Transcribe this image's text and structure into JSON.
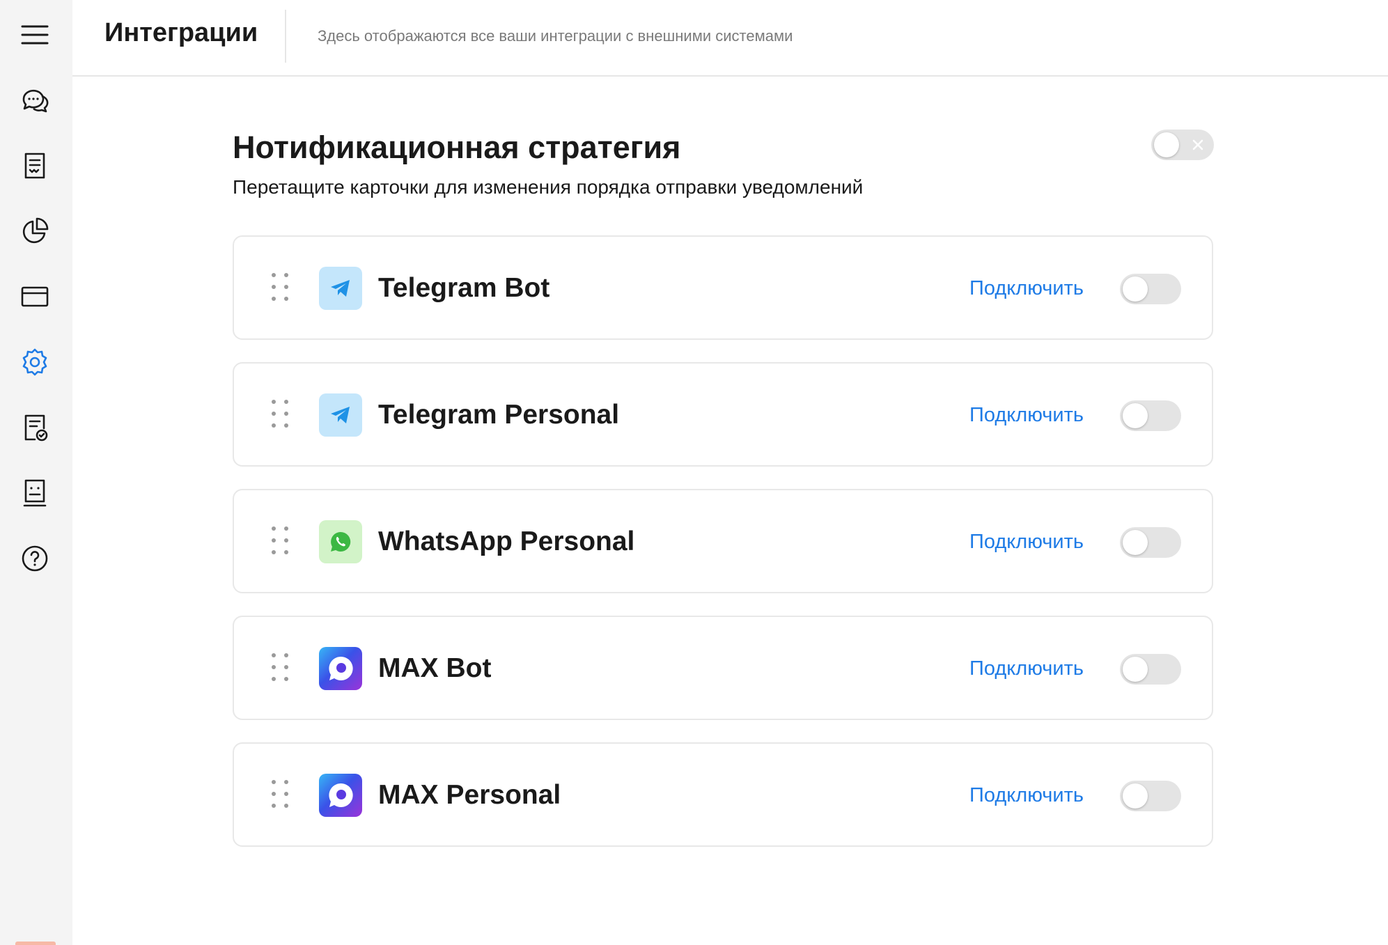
{
  "header": {
    "title": "Интеграции",
    "subtitle": "Здесь отображаются все ваши интеграции с внешними системами"
  },
  "sidebar": {
    "items": [
      {
        "icon": "menu-icon",
        "active": false
      },
      {
        "icon": "chat-icon",
        "active": false
      },
      {
        "icon": "document-list-icon",
        "active": false
      },
      {
        "icon": "pie-chart-icon",
        "active": false
      },
      {
        "icon": "card-icon",
        "active": false
      },
      {
        "icon": "gear-icon",
        "active": true
      },
      {
        "icon": "document-check-icon",
        "active": false
      },
      {
        "icon": "profile-card-icon",
        "active": false
      },
      {
        "icon": "help-icon",
        "active": false
      }
    ]
  },
  "strategy": {
    "title": "Нотификационная стратегия",
    "description": "Перетащите карточки для изменения порядка отправки уведомлений",
    "enabled": false
  },
  "integrations": [
    {
      "name": "Telegram Bot",
      "icon": "telegram-icon",
      "action_label": "Подключить",
      "enabled": false
    },
    {
      "name": "Telegram Personal",
      "icon": "telegram-icon",
      "action_label": "Подключить",
      "enabled": false
    },
    {
      "name": "WhatsApp Personal",
      "icon": "whatsapp-icon",
      "action_label": "Подключить",
      "enabled": false
    },
    {
      "name": "MAX Bot",
      "icon": "max-icon",
      "action_label": "Подключить",
      "enabled": false
    },
    {
      "name": "MAX Personal",
      "icon": "max-icon",
      "action_label": "Подключить",
      "enabled": false
    }
  ],
  "colors": {
    "accent": "#1e7be6",
    "sidebar_bg": "#f4f4f4",
    "toggle_off": "#e4e4e4",
    "icon": "#1a1a1a"
  }
}
